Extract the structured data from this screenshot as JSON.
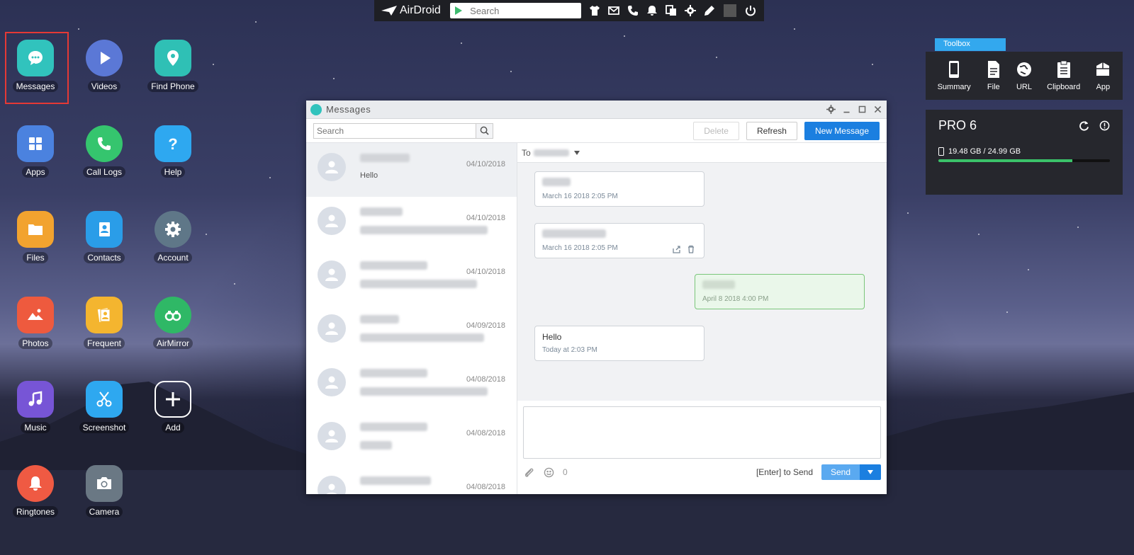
{
  "topbar": {
    "brand": "AirDroid",
    "search_placeholder": "Search",
    "icons": [
      "tshirt-icon",
      "mail-icon",
      "phone-icon",
      "bell-icon",
      "screens-icon",
      "gear-icon",
      "edit-icon",
      "power-icon"
    ]
  },
  "desktop": {
    "apps": [
      {
        "label": "Messages",
        "icon": "chat-icon",
        "color": "#31c3bd"
      },
      {
        "label": "Videos",
        "icon": "play-icon",
        "color": "#5b78d6"
      },
      {
        "label": "Find Phone",
        "icon": "location-pin-icon",
        "color": "#2fc0b5"
      },
      {
        "label": "Apps",
        "icon": "grid-icon",
        "color": "#4b82df"
      },
      {
        "label": "Call Logs",
        "icon": "phone-icon",
        "color": "#35c56e"
      },
      {
        "label": "Help",
        "icon": "question-icon",
        "color": "#2ea8f0"
      },
      {
        "label": "Files",
        "icon": "folder-icon",
        "color": "#f2a32f"
      },
      {
        "label": "Contacts",
        "icon": "contacts-icon",
        "color": "#2a9de8"
      },
      {
        "label": "Account",
        "icon": "gear-icon",
        "color": "#5f7788"
      },
      {
        "label": "Photos",
        "icon": "image-icon",
        "color": "#ee5a3e"
      },
      {
        "label": "Frequent",
        "icon": "frequent-icon",
        "color": "#f4b52f"
      },
      {
        "label": "AirMirror",
        "icon": "binoculars-icon",
        "color": "#2fb866"
      },
      {
        "label": "Music",
        "icon": "music-icon",
        "color": "#7755d6"
      },
      {
        "label": "Screenshot",
        "icon": "scissors-icon",
        "color": "#2ea8f0"
      },
      {
        "label": "Add",
        "icon": "plus-icon",
        "color": "transparent"
      },
      {
        "label": "Ringtones",
        "icon": "bell-icon",
        "color": "#ef5a43"
      },
      {
        "label": "Camera",
        "icon": "camera-icon",
        "color": "#6a7884"
      }
    ]
  },
  "messages_window": {
    "title": "Messages",
    "search_placeholder": "Search",
    "delete_label": "Delete",
    "refresh_label": "Refresh",
    "new_message_label": "New Message",
    "conversations": [
      {
        "date": "04/10/2018",
        "preview": "Hello",
        "active": true
      },
      {
        "date": "04/10/2018",
        "preview": "",
        "active": false
      },
      {
        "date": "04/10/2018",
        "preview": "",
        "active": false
      },
      {
        "date": "04/09/2018",
        "preview": "",
        "active": false
      },
      {
        "date": "04/08/2018",
        "preview": "",
        "active": false
      },
      {
        "date": "04/08/2018",
        "preview": "",
        "active": false
      },
      {
        "date": "04/08/2018",
        "preview": "",
        "active": false
      }
    ],
    "to_label": "To",
    "messages": [
      {
        "text": "",
        "time": "March 16 2018 2:05 PM",
        "direction": "in"
      },
      {
        "text": "",
        "time": "March 16 2018 2:05 PM",
        "direction": "in"
      },
      {
        "text": "",
        "time": "April 8 2018 4:00 PM",
        "direction": "out"
      },
      {
        "text": "Hello",
        "time": "Today at 2:03 PM",
        "direction": "in"
      }
    ],
    "char_count": "0",
    "enter_hint": "[Enter] to Send",
    "send_label": "Send"
  },
  "toolbox": {
    "tab_label": "Toolbox",
    "tools": [
      {
        "label": "Summary",
        "icon": "phone-device-icon"
      },
      {
        "label": "File",
        "icon": "file-icon"
      },
      {
        "label": "URL",
        "icon": "globe-icon"
      },
      {
        "label": "Clipboard",
        "icon": "clipboard-icon"
      },
      {
        "label": "App",
        "icon": "app-box-icon"
      }
    ],
    "device_name": "PRO 6",
    "storage_text": "19.48 GB / 24.99 GB",
    "storage_fraction": 0.78
  }
}
